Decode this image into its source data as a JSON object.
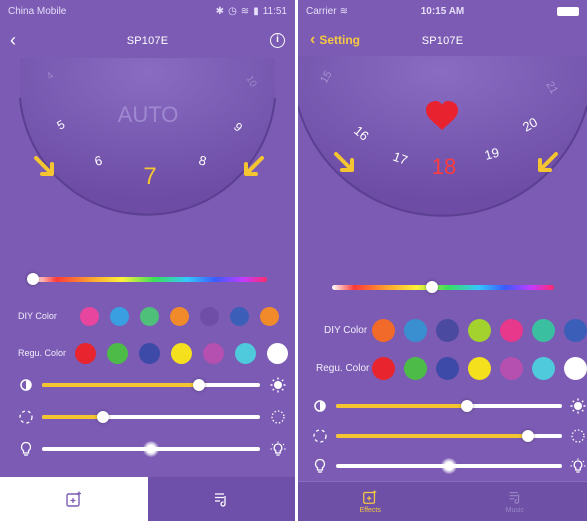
{
  "left": {
    "statusbar": {
      "carrier": "China Mobile",
      "time": "11:51"
    },
    "navbar": {
      "title": "SP107E",
      "back_icon": "chevron-left-icon",
      "info_icon": "info-icon",
      "info_glyph": "i"
    },
    "dial": {
      "mode": "AUTO",
      "numbers": {
        "far_left": "4",
        "far_right": "10",
        "left_outer": "5",
        "right_outer": "9",
        "left_inner": "6",
        "right_inner": "8",
        "selected": "7"
      }
    },
    "color_bar": {
      "position": 0.0
    },
    "diy": {
      "label": "DIY Color",
      "colors": [
        "#e8469e",
        "#3a9fe0",
        "#4fc07a",
        "#f08a2a",
        "#6f4ea8",
        "#3b5fb8",
        "#f08a2a"
      ]
    },
    "regu": {
      "label": "Regu. Color",
      "colors": [
        "#e8252e",
        "#4cbb47",
        "#3d4aa8",
        "#f5e01e",
        "#b54fb0",
        "#4fc9dc",
        "#ffffff"
      ]
    },
    "sliders": {
      "brightness": {
        "value": 0.72,
        "icon": "brightness-low-icon",
        "icon_end": "brightness-high-icon"
      },
      "speed": {
        "value": 0.28,
        "icon": "speed-slow-icon",
        "icon_end": "speed-fast-icon"
      },
      "light": {
        "value": 0.5,
        "icon": "bulb-off-icon",
        "icon_end": "bulb-on-icon"
      }
    },
    "tabs": [
      {
        "icon": "effects-icon",
        "active": true
      },
      {
        "icon": "music-icon",
        "active": false
      }
    ]
  },
  "right": {
    "statusbar": {
      "carrier": "Carrier",
      "time": "10:15 AM"
    },
    "navbar": {
      "title": "SP107E",
      "back_label": "Setting"
    },
    "dial": {
      "numbers": {
        "far_left": "15",
        "far_right": "21",
        "left_outer": "16",
        "right_outer": "20",
        "left_inner": "17",
        "right_inner": "19",
        "selected": "18"
      },
      "heart_icon": "heart-icon"
    },
    "color_bar": {
      "position": 0.45
    },
    "diy": {
      "label": "DIY Color",
      "colors": [
        "#f26a2a",
        "#3a8fd0",
        "#4a4aa0",
        "#a3d12e",
        "#e8388c",
        "#3ac0a0",
        "#3b5fb8"
      ]
    },
    "regu": {
      "label": "Regu. Color",
      "colors": [
        "#e8252e",
        "#4cbb47",
        "#3d4aa8",
        "#f5e01e",
        "#b54fb0",
        "#4fc9dc",
        "#ffffff"
      ]
    },
    "sliders": {
      "brightness": {
        "value": 0.58,
        "icon": "brightness-low-icon",
        "icon_end": "brightness-high-icon"
      },
      "speed": {
        "value": 0.85,
        "icon": "speed-slow-icon",
        "icon_end": "speed-fast-icon"
      },
      "light": {
        "value": 0.5,
        "icon": "bulb-off-icon",
        "icon_end": "bulb-on-icon"
      }
    },
    "tabs": [
      {
        "label": "Effects",
        "icon": "effects-icon",
        "active": true
      },
      {
        "label": "Music",
        "icon": "music-icon",
        "active": false
      }
    ]
  },
  "colors": {
    "background": "#7b5bb3",
    "accent": "#f4c531",
    "selected_number": "#f4c531",
    "selected_number_right": "#ff3b3b"
  }
}
